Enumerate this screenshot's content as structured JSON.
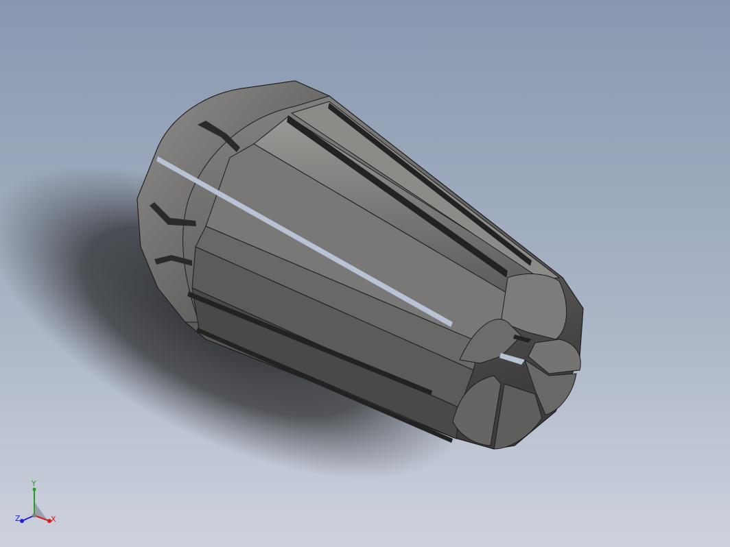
{
  "viewport": {
    "model": "collet-3d-model",
    "colors": {
      "background_top": "#8898b0",
      "background_bottom": "#cdd2dd",
      "body_fill": "#6c6a69",
      "face_fill": "#7c7a78",
      "slot_dark": "#222222",
      "highlight": "#9a9895"
    }
  },
  "triad": {
    "x_label": "X",
    "y_label": "Y",
    "z_label": "Z",
    "x_color": "#d02020",
    "y_color": "#20a020",
    "z_color": "#2020d0"
  }
}
